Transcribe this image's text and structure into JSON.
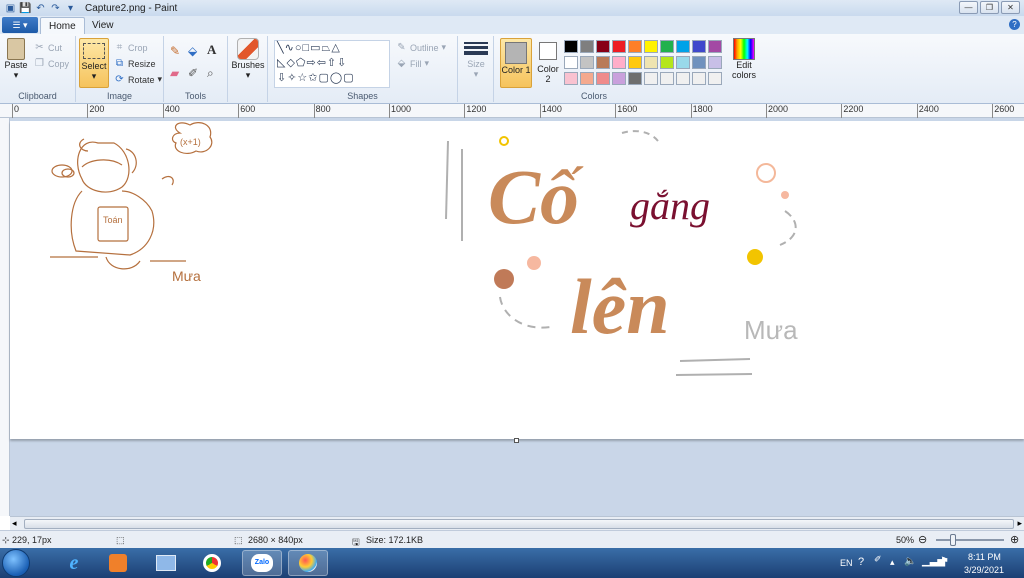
{
  "window": {
    "title": "Capture2.png - Paint"
  },
  "tabs": {
    "home": "Home",
    "view": "View"
  },
  "clipboard": {
    "paste": "Paste",
    "cut": "Cut",
    "copy": "Copy",
    "label": "Clipboard"
  },
  "image": {
    "select": "Select",
    "crop": "Crop",
    "resize": "Resize",
    "rotate": "Rotate",
    "label": "Image"
  },
  "tools": {
    "label": "Tools"
  },
  "brushes": {
    "label": "Brushes"
  },
  "shapes": {
    "outline": "Outline",
    "fill": "Fill",
    "label": "Shapes"
  },
  "size": {
    "label": "Size"
  },
  "colors": {
    "color1": "Color 1",
    "color2": "Color 2",
    "edit": "Edit colors",
    "label": "Colors",
    "color1_value": "#b4b4b4",
    "color2_value": "#ffffff",
    "palette_row1": [
      "#000000",
      "#7f7f7f",
      "#880015",
      "#ed1c24",
      "#ff7f27",
      "#fff200",
      "#22b14c",
      "#00a2e8",
      "#3f48cc",
      "#a349a4"
    ],
    "palette_row2": [
      "#ffffff",
      "#c3c3c3",
      "#b97a57",
      "#ffaec9",
      "#ffc90e",
      "#efe4b0",
      "#b5e61d",
      "#99d9ea",
      "#7092be",
      "#c8bfe7"
    ],
    "palette_row3": [
      "#f9c2d0",
      "#f4a98e",
      "#ef8b8b",
      "#c9a0dc",
      "#6e6e6e",
      "#f0f0f0",
      "#f0f0f0",
      "#f0f0f0",
      "#f0f0f0",
      "#f0f0f0"
    ]
  },
  "ruler": {
    "labels": [
      "0",
      "200",
      "400",
      "600",
      "800",
      "1000",
      "1200",
      "1400",
      "1600",
      "1800",
      "2000",
      "2200",
      "2400",
      "2600"
    ]
  },
  "artwork": {
    "title_word1": "Cố",
    "title_word2": "gắng",
    "title_word3": "lên",
    "signature": "Mưa",
    "signature_small": "Mưa",
    "book_text": "Toán",
    "thought": "(x+1)"
  },
  "status": {
    "cursor": "229, 17px",
    "dimensions": "2680 × 840px",
    "size": "Size: 172.1KB",
    "zoom": "50%"
  },
  "taskbar": {
    "lang": "EN",
    "time": "8:11 PM",
    "date": "3/29/2021",
    "zalo": "Zalo"
  }
}
